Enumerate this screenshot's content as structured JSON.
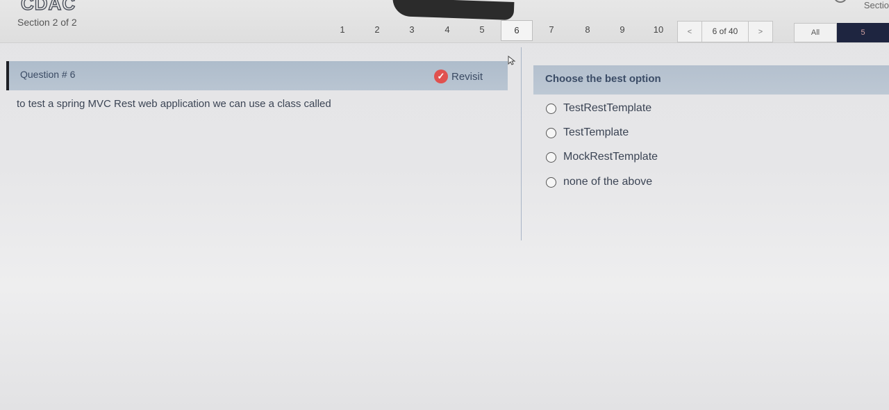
{
  "header": {
    "logo": "CDAC",
    "section": "Section 2 of 2",
    "section_right": "Sectio"
  },
  "nav": {
    "numbers": [
      "1",
      "2",
      "3",
      "4",
      "5",
      "6",
      "7",
      "8",
      "9",
      "10"
    ],
    "active": "6",
    "prev": "<",
    "next": ">",
    "counter": "6 of 40",
    "filter_all": "All",
    "filter_other": "5"
  },
  "question": {
    "title": "Question # 6",
    "revisit_label": "Revisit",
    "text": "to test a spring MVC Rest web application we can use a class called"
  },
  "options": {
    "title": "Choose the best option",
    "items": [
      "TestRestTemplate",
      "TestTemplate",
      "MockRestTemplate",
      "none of the above"
    ]
  },
  "colors": {
    "header_bar": "#b4c0ce",
    "accent_dark": "#1e2540",
    "revisit_icon": "#e0514f"
  }
}
